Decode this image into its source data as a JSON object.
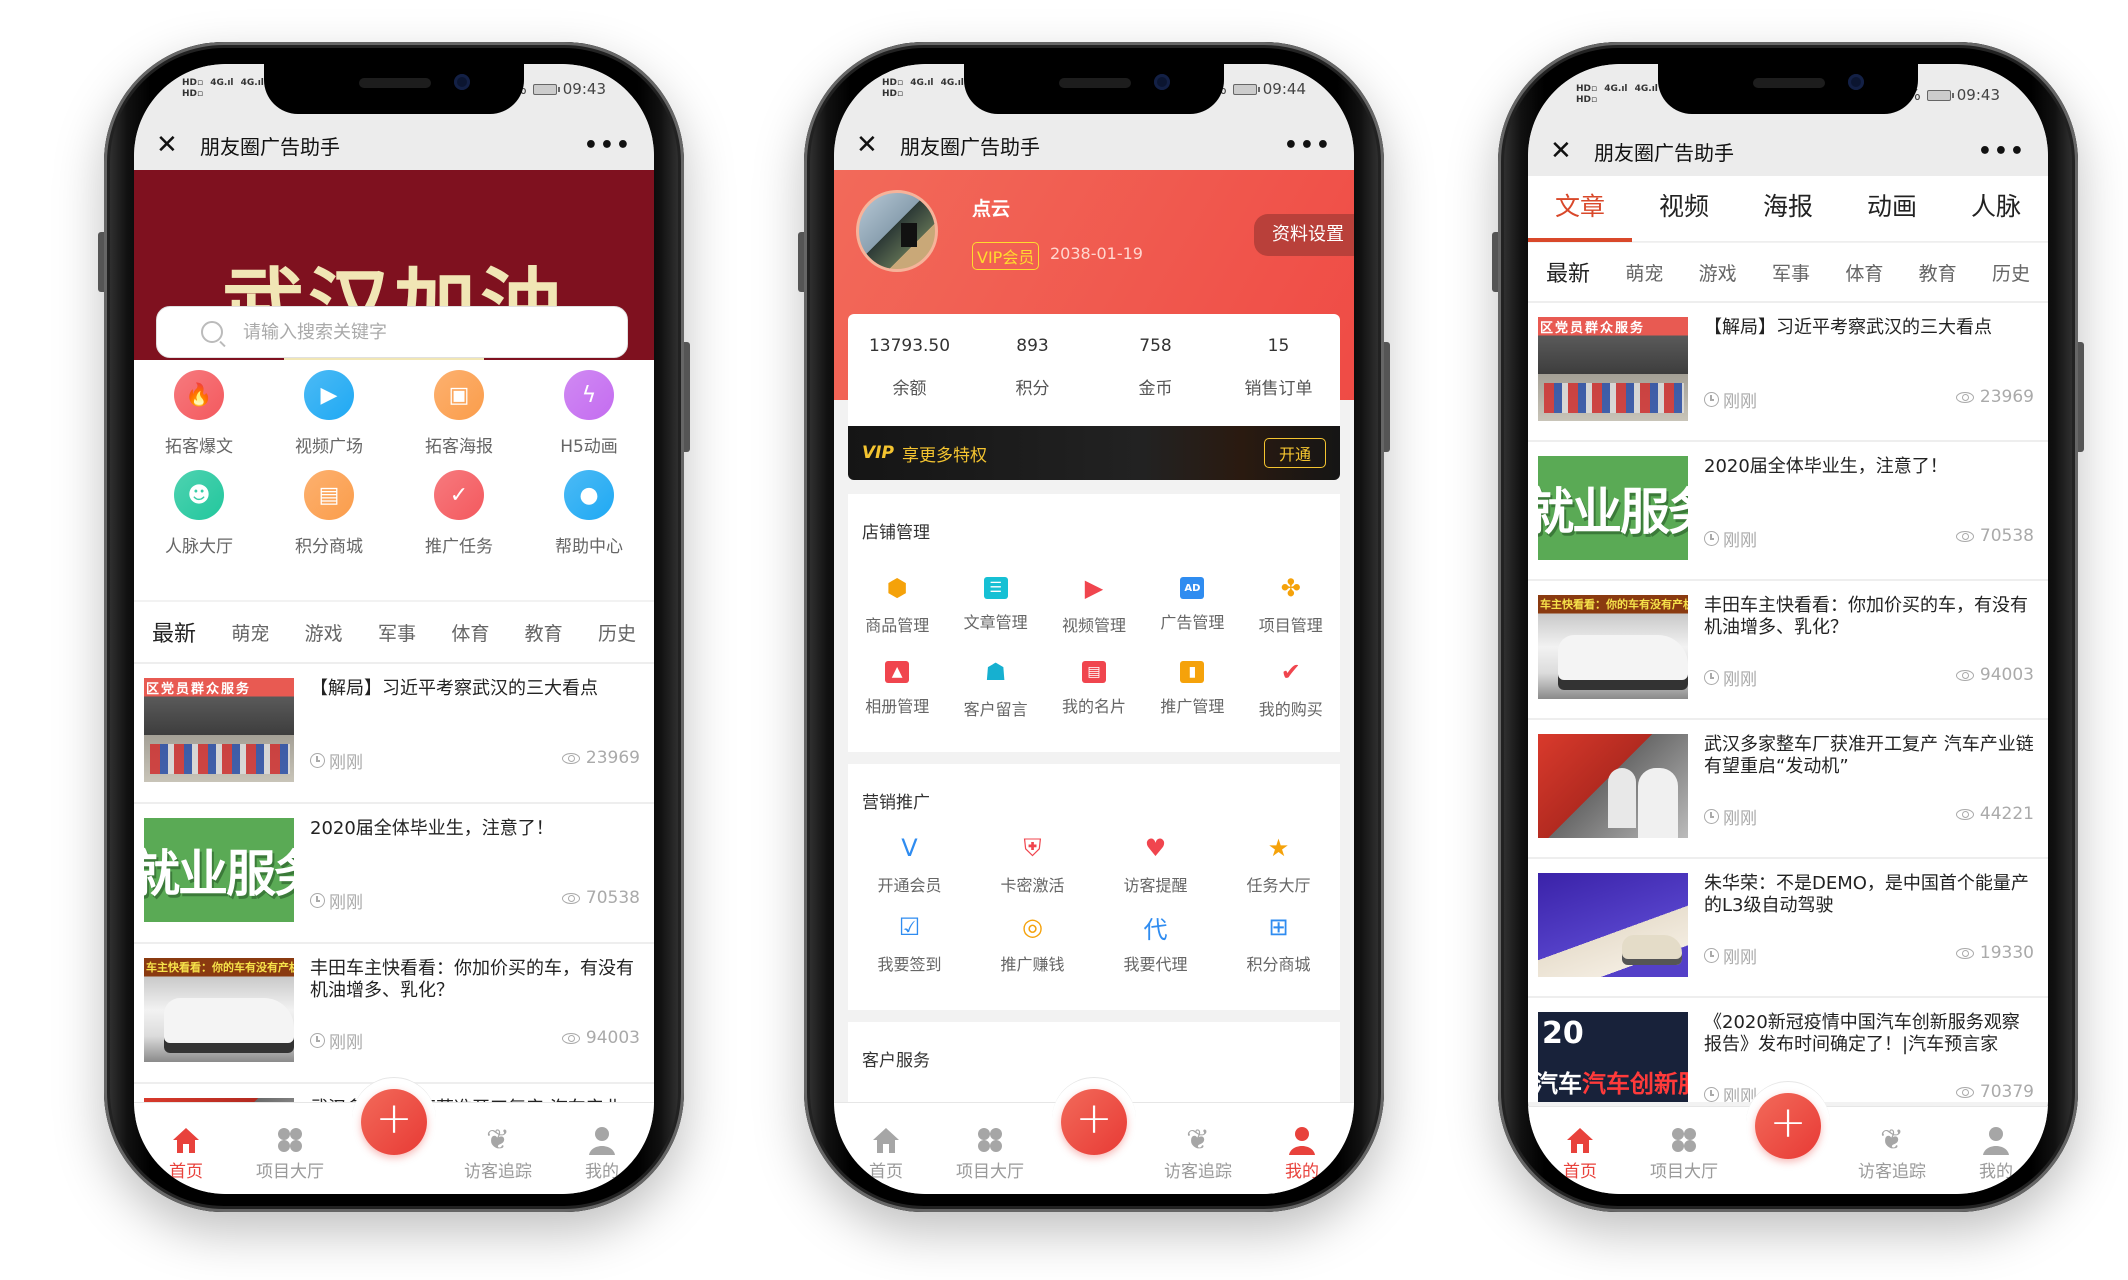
{
  "app_title": "朋友圈广告助手",
  "status_bar": {
    "left_indicators": [
      "HD",
      "4G",
      "4G"
    ],
    "phone1_time": "09:43",
    "phone2_time": "09:44",
    "phone3_time": "09:43"
  },
  "bottom_nav": {
    "items": [
      {
        "label": "首页",
        "icon": "home-icon"
      },
      {
        "label": "项目大厅",
        "icon": "grid-icon"
      },
      {
        "label": "+",
        "icon": "plus-icon"
      },
      {
        "label": "访客追踪",
        "icon": "footprint-icon"
      },
      {
        "label": "我的",
        "icon": "user-icon"
      }
    ],
    "accent": "#e8423c"
  },
  "phone1": {
    "banner_text": "武汉加油",
    "search_placeholder": "请输入搜索关键字",
    "quick_items": [
      {
        "label": "拓客爆文",
        "icon": "flame-icon",
        "color": "#f4595e"
      },
      {
        "label": "视频广场",
        "icon": "video-icon",
        "color": "#1fa9f3"
      },
      {
        "label": "拓客海报",
        "icon": "image-icon",
        "color": "#fb9d4b"
      },
      {
        "label": "H5动画",
        "icon": "flash-icon",
        "color": "#c46cf0"
      },
      {
        "label": "人脉大厅",
        "icon": "people-icon",
        "color": "#22c79d"
      },
      {
        "label": "积分商城",
        "icon": "store-icon",
        "color": "#fb9d4b"
      },
      {
        "label": "推广任务",
        "icon": "clipboard-icon",
        "color": "#f4595e"
      },
      {
        "label": "帮助中心",
        "icon": "bulb-icon",
        "color": "#1fa9f3"
      }
    ],
    "categories": [
      "最新",
      "萌宠",
      "游戏",
      "军事",
      "体育",
      "教育",
      "历史"
    ],
    "active_category": "最新"
  },
  "articles": [
    {
      "title": "【解局】习近平考察武汉的三大看点",
      "time": "刚刚",
      "views": "23969",
      "thumb_text": "区党员群众服务"
    },
    {
      "title": "2020届全体毕业生，注意了！",
      "time": "刚刚",
      "views": "70538",
      "thumb_text": "就业服务"
    },
    {
      "title": "丰田车主快看看：你加价买的车，有没有机油增多、乳化？",
      "time": "刚刚",
      "views": "94003",
      "thumb_text": "车主快看看：你的车有没有产机"
    },
    {
      "title": "武汉多家整车厂获准开工复产 汽车产业链有望重启“发动机”",
      "time": "刚刚",
      "views": "44221",
      "thumb_text": ""
    },
    {
      "title": "朱华荣：不是DEMO，是中国首个能量产的L3级自动驾驶",
      "time": "刚刚",
      "views": "19330",
      "thumb_text": ""
    },
    {
      "title": "《2020新冠疫情中国汽车创新服务观察报告》发布时间确定了！|汽车预言家",
      "time": "刚刚",
      "views": "70379",
      "thumb_text": "汽车创新服务"
    }
  ],
  "phone1_partial_article": "武汉多家整车厂获准开工复产 汽车产业",
  "phone2": {
    "username": "点云",
    "vip_badge": "VIP会员",
    "vip_expiry": "2038-01-19",
    "settings_button": "资料设置",
    "stats": [
      {
        "value": "13793.50",
        "label": "余额"
      },
      {
        "value": "893",
        "label": "积分"
      },
      {
        "value": "758",
        "label": "金币"
      },
      {
        "value": "15",
        "label": "销售订单"
      }
    ],
    "vip_bar": {
      "logo": "VIP",
      "text": "享更多特权",
      "button": "开通"
    },
    "sections": [
      {
        "title": "店铺管理",
        "items": [
          {
            "label": "商品管理",
            "icon": "box-icon",
            "color": "#f5a20a"
          },
          {
            "label": "文章管理",
            "icon": "article-icon",
            "color": "#16c0d4"
          },
          {
            "label": "视频管理",
            "icon": "video-clap-icon",
            "color": "#f0454e"
          },
          {
            "label": "广告管理",
            "icon": "ad-icon",
            "color": "#2f8cf0"
          },
          {
            "label": "项目管理",
            "icon": "clover-icon",
            "color": "#f5a20a"
          },
          {
            "label": "相册管理",
            "icon": "photo-icon",
            "color": "#f0454e"
          },
          {
            "label": "客户留言",
            "icon": "message-user-icon",
            "color": "#16b0d0"
          },
          {
            "label": "我的名片",
            "icon": "id-card-icon",
            "color": "#f0454e"
          },
          {
            "label": "推广管理",
            "icon": "bar-chart-icon",
            "color": "#f5a20a"
          },
          {
            "label": "我的购买",
            "icon": "cart-icon",
            "color": "#f0454e"
          }
        ]
      },
      {
        "title": "营销推广",
        "items": [
          {
            "label": "开通会员",
            "icon": "vip-diamond-icon",
            "color": "#2f8cf0"
          },
          {
            "label": "卡密激活",
            "icon": "shield-lock-icon",
            "color": "#f0454e"
          },
          {
            "label": "访客提醒",
            "icon": "user-heart-icon",
            "color": "#f0454e"
          },
          {
            "label": "任务大厅",
            "icon": "bookmark-star-icon",
            "color": "#f5a20a"
          },
          {
            "label": "我要签到",
            "icon": "calendar-check-icon",
            "color": "#2f8cf0"
          },
          {
            "label": "推广赚钱",
            "icon": "coins-icon",
            "color": "#f5a20a"
          },
          {
            "label": "我要代理",
            "icon": "agent-icon",
            "color": "#2f8cf0"
          },
          {
            "label": "积分商城",
            "icon": "gift-icon",
            "color": "#2f8cf0"
          }
        ]
      },
      {
        "title": "客户服务",
        "items": [
          {
            "label": "",
            "icon": "headset-icon",
            "color": "#f0454e"
          },
          {
            "label": "",
            "icon": "info-icon",
            "color": "#16b0d0"
          },
          {
            "label": "",
            "icon": "bulb-icon",
            "color": "#f5a20a"
          },
          {
            "label": "",
            "icon": "book-icon",
            "color": "#f0454e"
          }
        ]
      }
    ]
  },
  "phone3": {
    "top_tabs": [
      "文章",
      "视频",
      "海报",
      "动画",
      "人脉"
    ],
    "active_tab": "文章",
    "categories": [
      "最新",
      "萌宠",
      "游戏",
      "军事",
      "体育",
      "教育",
      "历史"
    ],
    "active_category": "最新",
    "accent": "#d9482a"
  }
}
